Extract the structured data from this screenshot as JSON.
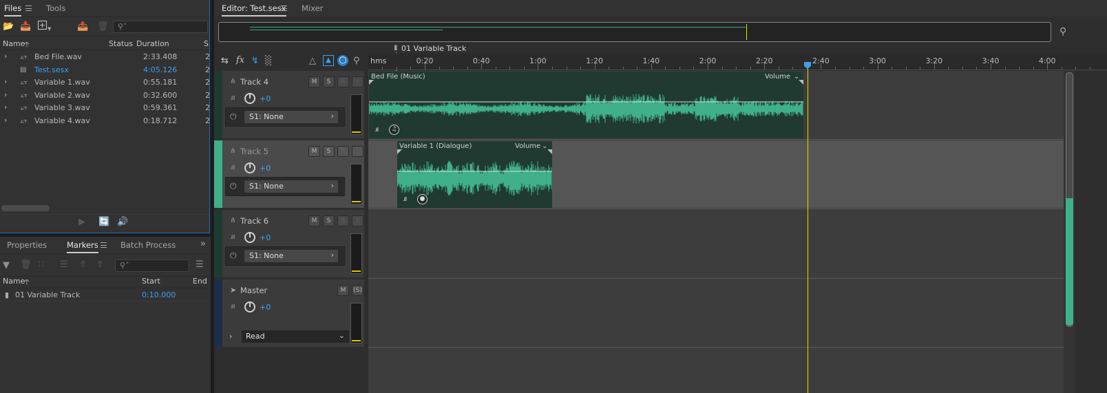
{
  "files_panel": {
    "tabs": [
      {
        "label": "Files"
      },
      {
        "label": "Tools"
      }
    ],
    "columns": {
      "name": "Name",
      "status": "Status",
      "duration": "Duration",
      "extra": "S"
    },
    "rows": [
      {
        "name": "Bed File.wav",
        "duration": "2:33.408",
        "extra": "2",
        "expandable": true,
        "selected": false
      },
      {
        "name": "Test.sesx",
        "duration": "4:05.126",
        "extra": "2",
        "expandable": false,
        "selected": true
      },
      {
        "name": "Variable 1.wav",
        "duration": "0:55.181",
        "extra": "2",
        "expandable": true,
        "selected": false
      },
      {
        "name": "Variable 2.wav",
        "duration": "0:32.600",
        "extra": "2",
        "expandable": true,
        "selected": false
      },
      {
        "name": "Variable 3.wav",
        "duration": "0:59.361",
        "extra": "2",
        "expandable": true,
        "selected": false
      },
      {
        "name": "Variable 4.wav",
        "duration": "0:18.712",
        "extra": "2",
        "expandable": true,
        "selected": false
      }
    ]
  },
  "markers_panel": {
    "tabs": [
      {
        "label": "Properties"
      },
      {
        "label": "Markers"
      },
      {
        "label": "Batch Process"
      }
    ],
    "columns": {
      "name": "Name",
      "start": "Start",
      "end": "End"
    },
    "rows": [
      {
        "name": "01 Variable Track",
        "start": "0:10.000"
      }
    ]
  },
  "editor": {
    "tabs": [
      {
        "label": "Editor: Test.sesx"
      },
      {
        "label": "Mixer"
      }
    ],
    "marker_label": "01 Variable Track",
    "ruler_unit": "hms",
    "ruler_labels": [
      "0:20",
      "0:40",
      "1:00",
      "1:20",
      "1:40",
      "2:00",
      "2:20",
      "2:40",
      "3:00",
      "3:20",
      "3:40",
      "4:00"
    ],
    "tracks": [
      {
        "name": "Track 4",
        "volume": "+0",
        "send": "S1: None",
        "accent": "#1e3b31"
      },
      {
        "name": "Track 5",
        "volume": "+0",
        "send": "S1: None",
        "accent": "#3fb08a"
      },
      {
        "name": "Track 6",
        "volume": "+0",
        "send": "S1: None",
        "accent": "#1e3b31"
      }
    ],
    "master": {
      "name": "Master",
      "volume": "+0",
      "mode": "Read",
      "accent": "#1c2e48"
    },
    "clips": [
      {
        "title": "Bed File (Music)",
        "envelope": "Volume"
      },
      {
        "title": "Variable 1 (Dialogue)",
        "envelope": "Volume"
      }
    ],
    "buttons": {
      "mute": "M",
      "solo": "S",
      "arm": "R",
      "input": "I",
      "master_solo": "(S)"
    }
  }
}
